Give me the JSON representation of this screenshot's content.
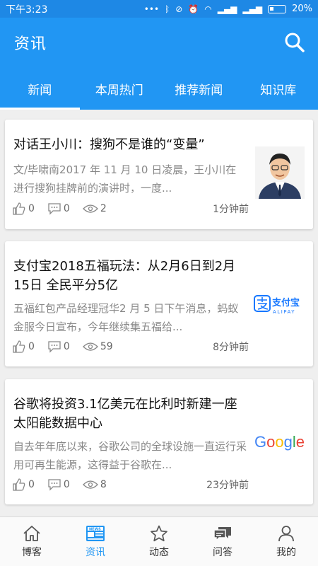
{
  "status": {
    "time": "下午3:23",
    "battery": "20%"
  },
  "app": {
    "title": "资讯"
  },
  "tabs": [
    {
      "label": "新闻",
      "active": true
    },
    {
      "label": "本周热门"
    },
    {
      "label": "推荐新闻"
    },
    {
      "label": "知识库"
    }
  ],
  "articles": [
    {
      "title": "对话王小川：搜狗不是谁的“变量”",
      "summary": "文/毕啸南2017 年 11 月 10 日凌晨，王小川在进行搜狗挂牌前的演讲时，一度...",
      "likes": "0",
      "comments": "0",
      "views": "2",
      "time": "1分钟前",
      "thumb": "person-photo"
    },
    {
      "title": "支付宝2018五福玩法：从2月6日到2月15日 全民平分5亿",
      "summary": "五福红包产品经理冠华2 月 5 日下午消息，蚂蚁金服今日宣布，今年继续集五福给...",
      "likes": "0",
      "comments": "0",
      "views": "59",
      "time": "8分钟前",
      "thumb": "alipay-logo",
      "thumb_text": "支付宝",
      "thumb_subtext": "ALIPAY"
    },
    {
      "title": "谷歌将投资3.1亿美元在比利时新建一座太阳能数据中心",
      "summary": "自去年年底以来，谷歌公司的全球设施一直运行采用可再生能源，这得益于谷歌在...",
      "likes": "0",
      "comments": "0",
      "views": "8",
      "time": "23分钟前",
      "thumb": "google-logo",
      "thumb_text": "Google"
    }
  ],
  "bottom_nav": [
    {
      "label": "博客",
      "icon": "home-icon"
    },
    {
      "label": "资讯",
      "icon": "news-icon",
      "active": true
    },
    {
      "label": "动态",
      "icon": "star-icon"
    },
    {
      "label": "问答",
      "icon": "chat-icon"
    },
    {
      "label": "我的",
      "icon": "person-icon"
    }
  ],
  "colors": {
    "primary": "#2196f3",
    "status_bar": "#1e88e5",
    "google_blue": "#4285f4",
    "google_red": "#ea4335",
    "google_yellow": "#fbbc05",
    "google_green": "#34a853",
    "alipay_blue": "#1677ff"
  }
}
